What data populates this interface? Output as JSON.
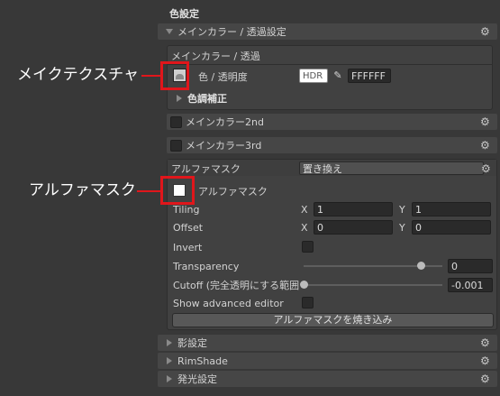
{
  "section_title": "色設定",
  "main_color_group": {
    "header": "メインカラー / 透過設定",
    "sub_header": "メインカラー / 透過",
    "color_label": "色 / 透明度",
    "hdr_badge": "HDR",
    "hex_value": "FFFFFF",
    "color_correction": "色調補正"
  },
  "main_color_2nd": "メインカラー2nd",
  "main_color_3rd": "メインカラー3rd",
  "alpha_mask": {
    "title": "アルファマスク",
    "mode_value": "置き換え",
    "texture_label": "アルファマスク",
    "tiling_label": "Tiling",
    "tiling_x": "1",
    "tiling_y": "1",
    "offset_label": "Offset",
    "offset_x": "0",
    "offset_y": "0",
    "axis_x": "X",
    "axis_y": "Y",
    "invert_label": "Invert",
    "transparency_label": "Transparency",
    "transparency_value": "0",
    "transparency_fraction": 0.85,
    "cutoff_label": "Cutoff (完全透明にする範囲",
    "cutoff_value": "-0.001",
    "cutoff_fraction": 0.0,
    "advanced_label": "Show advanced editor",
    "bake_button": "アルファマスクを焼き込み"
  },
  "shadow_settings": "影設定",
  "rimshade": "RimShade",
  "emission_settings": "発光設定",
  "callouts": {
    "make_texture": "メイクテクスチャ",
    "alpha_mask": "アルファマスク"
  },
  "colors": {
    "background": "#383838",
    "highlight": "#e0161b"
  }
}
